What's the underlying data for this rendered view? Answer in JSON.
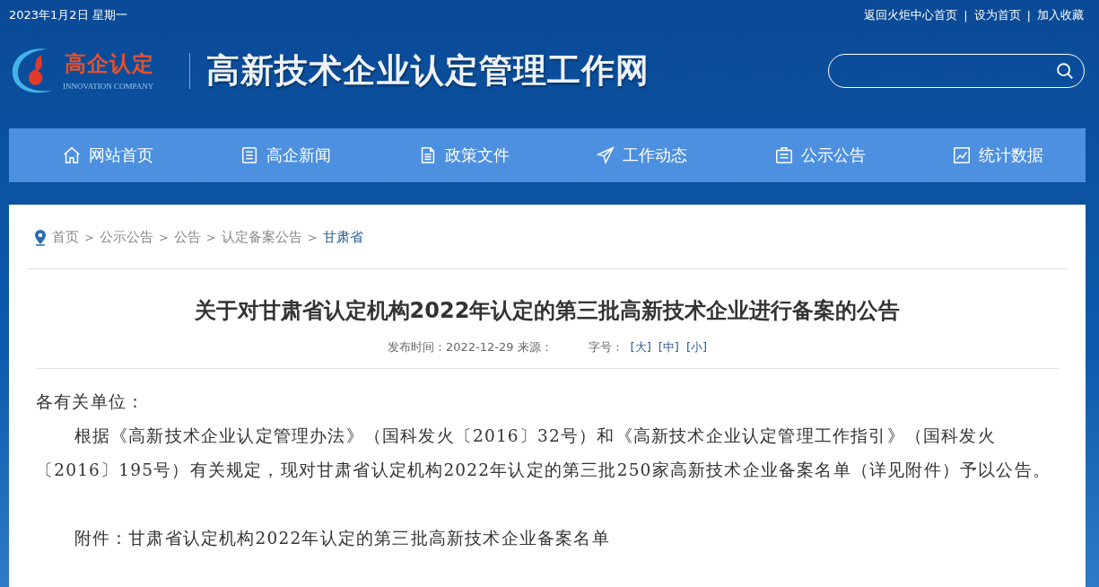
{
  "top_bar": {
    "date": "2023年1月2日 星期一",
    "links": [
      {
        "label": "返回火炬中心首页"
      },
      {
        "label": "设为首页"
      },
      {
        "label": "加入收藏"
      }
    ],
    "separator": "|"
  },
  "header": {
    "logo": {
      "name": "高企认定",
      "subtitle": "INNOVATION COMPANY"
    },
    "site_title": "高新技术企业认定管理工作网"
  },
  "nav": [
    {
      "label": "网站首页"
    },
    {
      "label": "高企新闻"
    },
    {
      "label": "政策文件"
    },
    {
      "label": "工作动态"
    },
    {
      "label": "公示公告"
    },
    {
      "label": "统计数据"
    }
  ],
  "breadcrumb": {
    "separator": ">",
    "items": [
      {
        "label": "首页",
        "current": false
      },
      {
        "label": "公示公告",
        "current": false
      },
      {
        "label": "公告",
        "current": false
      },
      {
        "label": "认定备案公告",
        "current": false
      },
      {
        "label": "甘肃省",
        "current": true
      }
    ]
  },
  "article": {
    "title": "关于对甘肃省认定机构2022年认定的第三批高新技术企业进行备案的公告",
    "meta": "发布时间：2022-12-29 来源：",
    "font_size_label": "字号：",
    "font_sizes": [
      {
        "label": "[大]"
      },
      {
        "label": "[中]"
      },
      {
        "label": "[小]"
      }
    ],
    "paragraphs": [
      {
        "kind": "salutation",
        "text": "各有关单位："
      },
      {
        "kind": "body",
        "text": "根据《高新技术企业认定管理办法》（国科发火〔2016〕32号）和《高新技术企业认定管理工作指引》（国科发火〔2016〕195号）有关规定，现对甘肃省认定机构2022年认定的第三批250家高新技术企业备案名单（详见附件）予以公告。"
      },
      {
        "kind": "gap"
      },
      {
        "kind": "body",
        "text": "附件：甘肃省认定机构2022年认定的第三批高新技术企业备案名单"
      }
    ]
  }
}
